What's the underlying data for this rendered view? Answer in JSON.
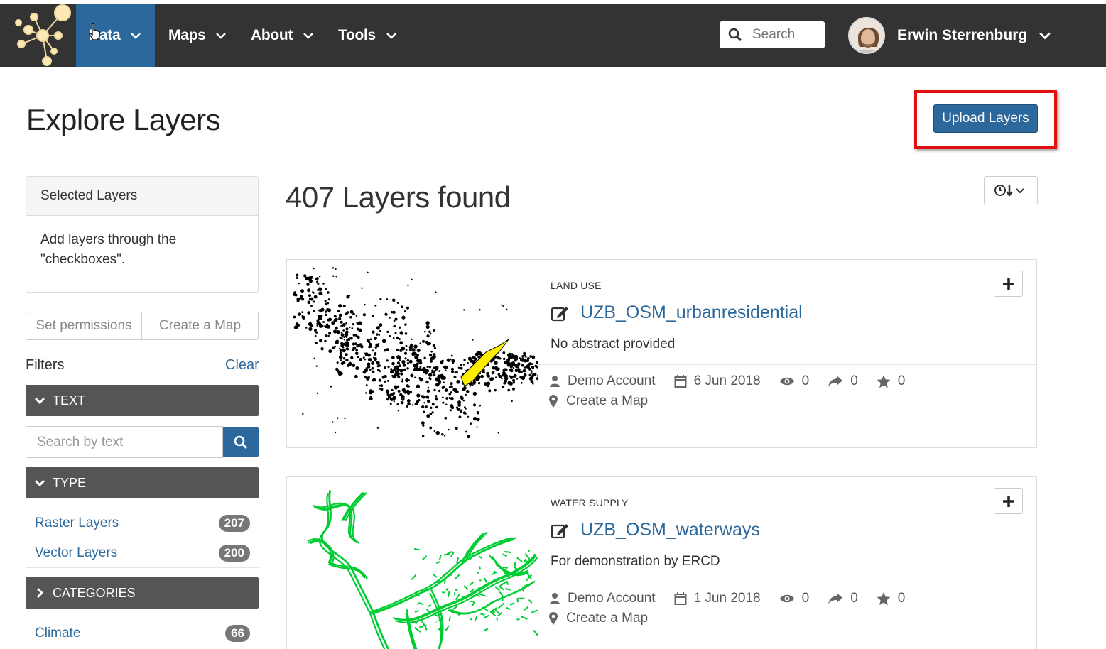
{
  "navbar": {
    "items": [
      {
        "label": "Data"
      },
      {
        "label": "Maps"
      },
      {
        "label": "About"
      },
      {
        "label": "Tools"
      }
    ],
    "search_placeholder": "Search",
    "user_name": "Erwin Sterrenburg"
  },
  "header": {
    "title": "Explore Layers",
    "upload_label": "Upload Layers"
  },
  "sidebar": {
    "selected_title": "Selected Layers",
    "selected_hint": "Add layers through the \"checkboxes\".",
    "set_permissions": "Set permissions",
    "create_map": "Create a Map",
    "filters_label": "Filters",
    "clear_label": "Clear",
    "text_facet": "TEXT",
    "text_search_placeholder": "Search by text",
    "type_facet": "TYPE",
    "types": [
      {
        "label": "Raster Layers",
        "count": "207"
      },
      {
        "label": "Vector Layers",
        "count": "200"
      }
    ],
    "categories_facet": "CATEGORIES",
    "categories": [
      {
        "label": "Climate",
        "count": "66"
      }
    ]
  },
  "results": {
    "count_text": "407 Layers found",
    "layers": [
      {
        "category": "LAND USE",
        "title": "UZB_OSM_urbanresidential",
        "abstract": "No abstract provided",
        "owner": "Demo Account",
        "date": "6 Jun 2018",
        "views": "0",
        "shares": "0",
        "rating": "0",
        "create_map": "Create a Map"
      },
      {
        "category": "WATER SUPPLY",
        "title": "UZB_OSM_waterways",
        "abstract": "For demonstration by ERCD",
        "owner": "Demo Account",
        "date": "1 Jun 2018",
        "views": "0",
        "shares": "0",
        "rating": "0",
        "create_map": "Create a Map"
      }
    ]
  },
  "colors": {
    "navbar": "#333333",
    "accent": "#2c689c",
    "highlight": "#e01010",
    "facet_head": "#555555"
  }
}
